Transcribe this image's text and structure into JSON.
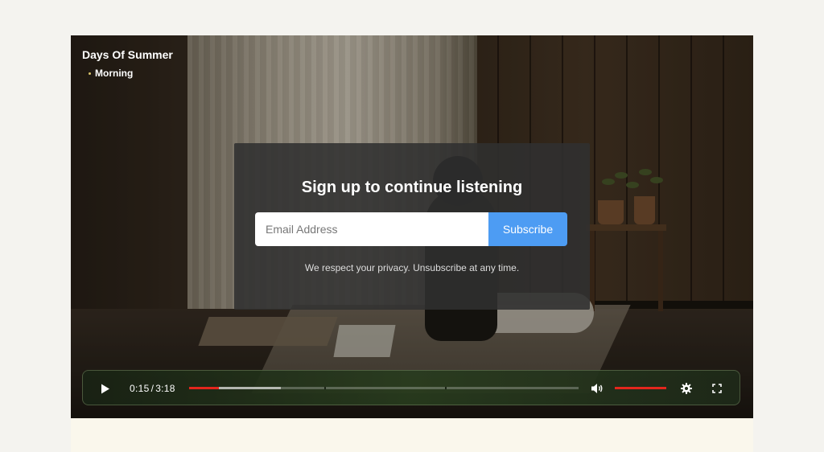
{
  "video": {
    "title": "Days Of Summer",
    "chapter": "Morning"
  },
  "signup": {
    "title": "Sign up to continue listening",
    "email_placeholder": "Email Address",
    "subscribe_label": "Subscribe",
    "privacy_note": "We respect your privacy. Unsubscribe at any time."
  },
  "controls": {
    "current_time": "0:15",
    "separator": "/",
    "duration": "3:18",
    "played_fraction": 0.076,
    "buffered_fraction": 0.236,
    "volume_fraction": 1.0,
    "icons": {
      "play": "play-icon",
      "volume": "volume-icon",
      "settings": "gear-icon",
      "fullscreen": "fullscreen-icon"
    }
  },
  "colors": {
    "accent": "#e3261d",
    "subscribe": "#4d9cf3",
    "page_background": "#f4f3ef"
  }
}
